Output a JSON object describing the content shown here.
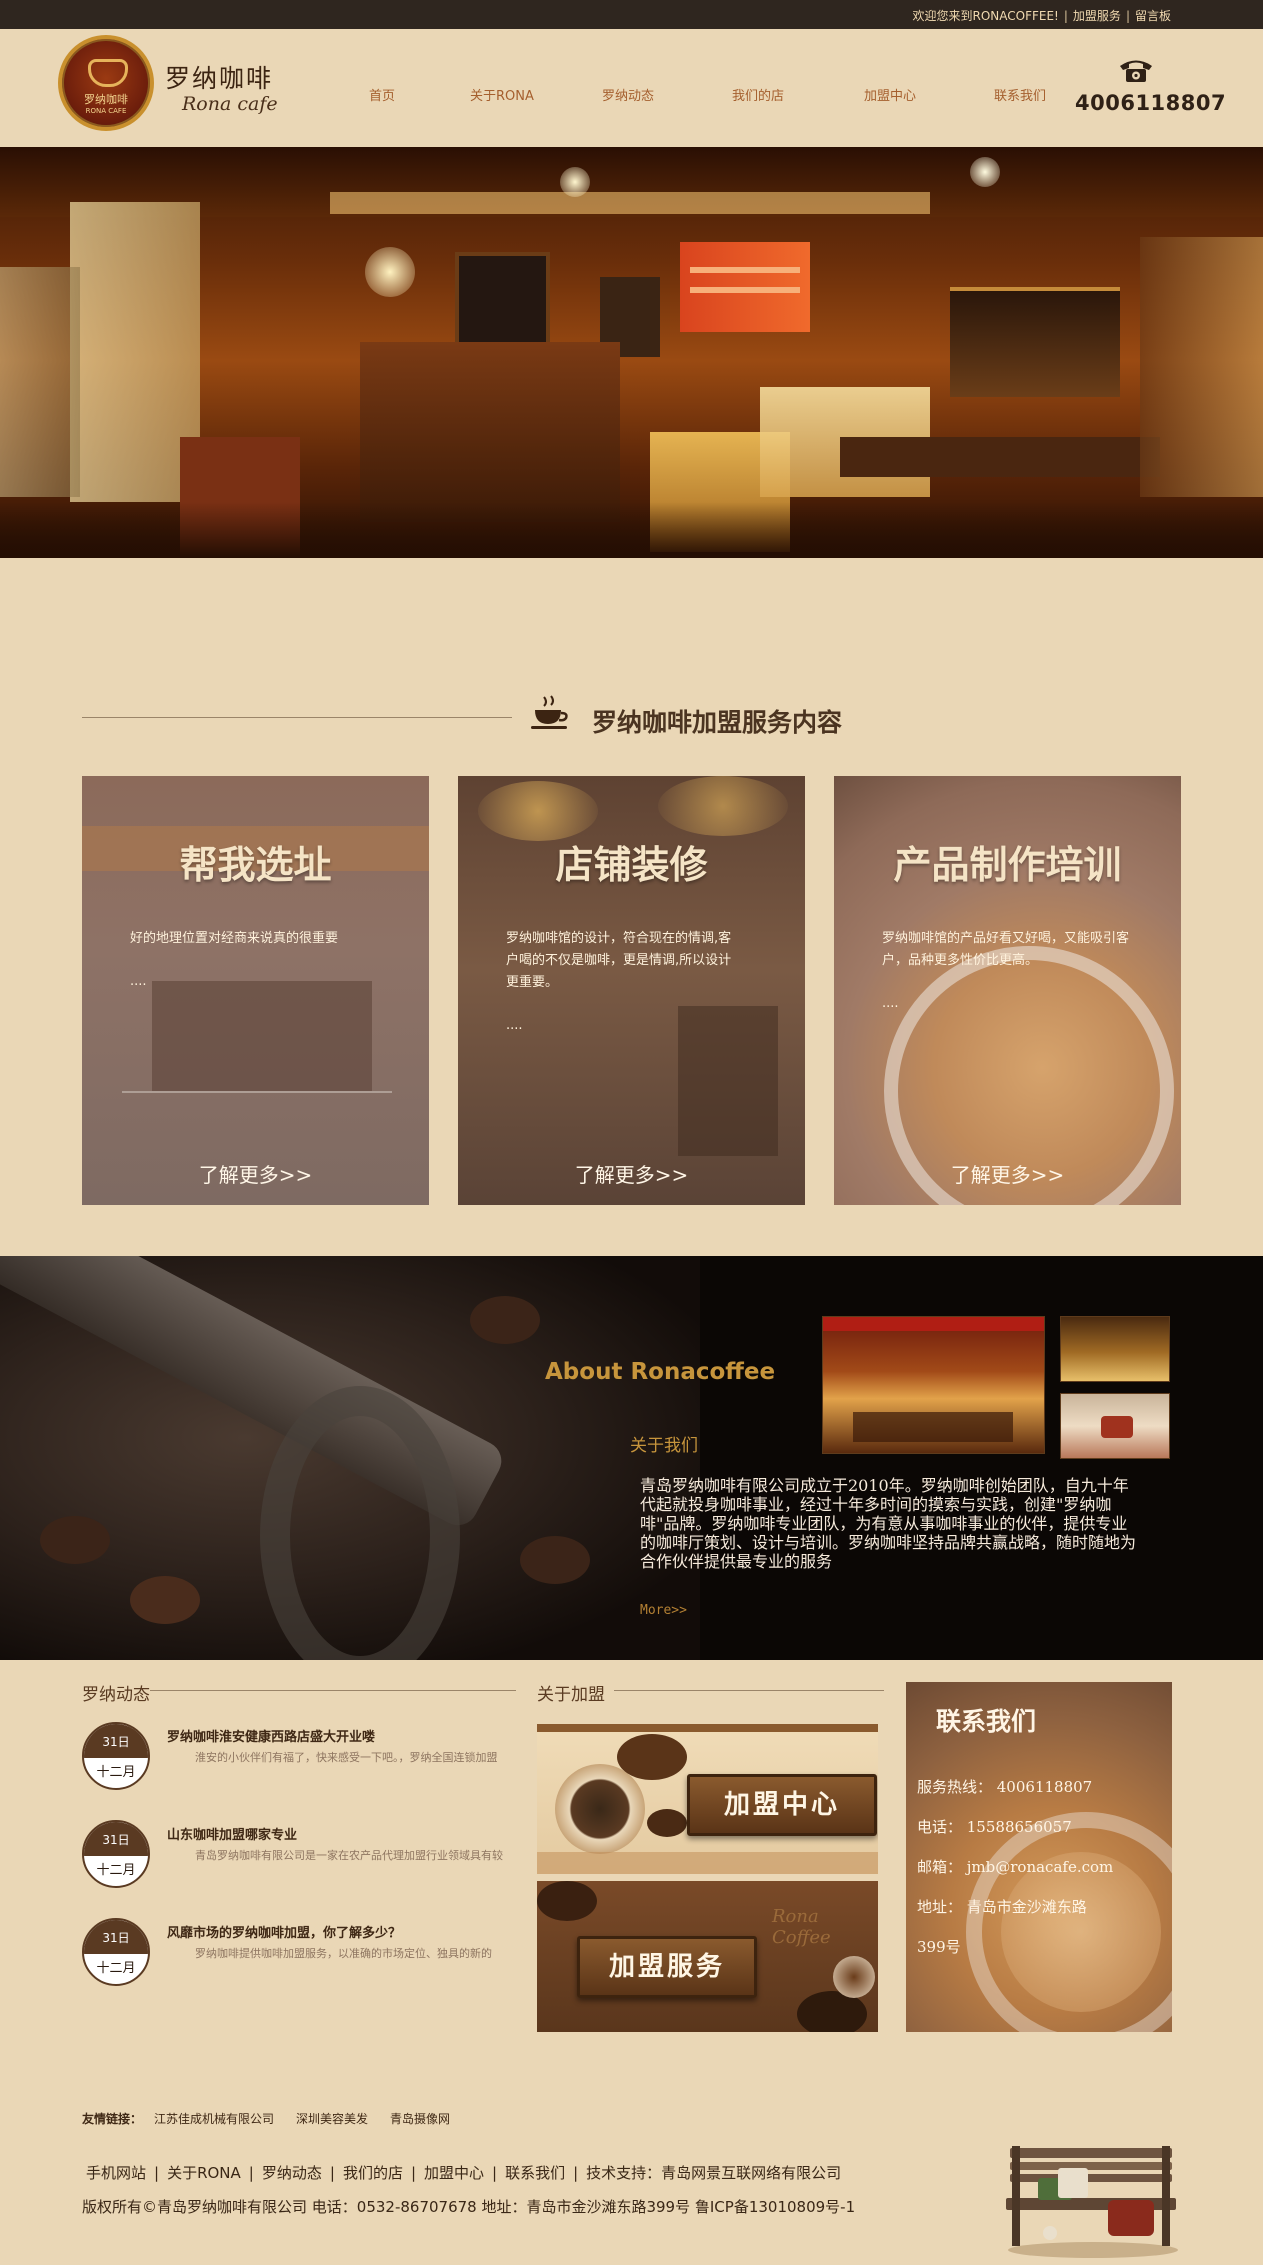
{
  "topbar": {
    "welcome": "欢迎您来到RONACOFFEE!",
    "sep1": "|",
    "franchise_link": "加盟服务",
    "sep2": "|",
    "guestbook_link": "留言板"
  },
  "header": {
    "logo_cn": "罗纳咖啡",
    "logo_en": "Rona cafe",
    "badge_cn": "罗纳咖啡",
    "badge_en": "RONA CAFE",
    "nav": [
      "首页",
      "关于RONA",
      "罗纳动态",
      "我们的店",
      "加盟中心",
      "联系我们"
    ],
    "phone": "4006118807",
    "phone_icon": "phone-icon"
  },
  "services": {
    "title": "罗纳咖啡加盟服务内容",
    "icon": "coffee-cup-icon",
    "cards": [
      {
        "title": "帮我选址",
        "desc": "好的地理位置对经商来说真的很重要",
        "dots": "....",
        "more": "了解更多>>"
      },
      {
        "title": "店铺装修",
        "desc": "罗纳咖啡馆的设计，符合现在的情调,客户喝的不仅是咖啡，更是情调,所以设计更重要。",
        "dots": "....",
        "more": "了解更多>>"
      },
      {
        "title": "产品制作培训",
        "desc": "罗纳咖啡馆的产品好看又好喝，又能吸引客户，品种更多性价比更高。",
        "dots": "....",
        "more": "了解更多>>"
      }
    ]
  },
  "about": {
    "title_en": "About Ronacoffee",
    "title_cn": "关于我们",
    "text": "青岛罗纳咖啡有限公司成立于2010年。罗纳咖啡创始团队，自九十年代起就投身咖啡事业，经过十年多时间的摸索与实践，创建\"罗纳咖啡\"品牌。罗纳咖啡专业团队，为有意从事咖啡事业的伙伴，提供专业的咖啡厅策划、设计与培训。罗纳咖啡坚持品牌共赢战略，随时随地为合作伙伴提供最专业的服务",
    "more": "More>>"
  },
  "news": {
    "title": "罗纳动态",
    "items": [
      {
        "day": "31日",
        "month": "十二月",
        "title": "罗纳咖啡淮安健康西路店盛大开业喽",
        "desc": "淮安的小伙伴们有福了，快来感受一下吧。，罗纳全国连锁加盟"
      },
      {
        "day": "31日",
        "month": "十二月",
        "title": "山东咖啡加盟哪家专业",
        "desc": "青岛罗纳咖啡有限公司是一家在农产品代理加盟行业领域具有较"
      },
      {
        "day": "31日",
        "month": "十二月",
        "title": "风靡市场的罗纳咖啡加盟，你了解多少？",
        "desc": "罗纳咖啡提供咖啡加盟服务，以准确的市场定位、独具的新的"
      }
    ]
  },
  "join": {
    "title": "关于加盟",
    "sign1": "加盟中心",
    "sign2": "加盟服务",
    "img2_script": "Rona Coffee"
  },
  "contact": {
    "title": "联系我们",
    "hotline": "服务热线：  4006118807",
    "phone": "电话：  15588656057",
    "email": "邮箱：  jmb@ronacafe.com",
    "address_line1": "地址：  青岛市金沙滩东路",
    "address_line2": "399号"
  },
  "footer": {
    "friend_label": "友情链接：",
    "friends": [
      "江苏佳成机械有限公司",
      "深圳美容美发",
      "青岛摄像网"
    ],
    "nav": [
      "手机网站",
      "关于RONA",
      "罗纳动态",
      "我们的店",
      "加盟中心",
      "联系我们",
      "技术支持：青岛网景互联网络有限公司"
    ],
    "separator": "|",
    "copyright": "版权所有©青岛罗纳咖啡有限公司  电话：0532-86707678  地址：青岛市金沙滩东路399号  鲁ICP备13010809号-1"
  },
  "colors": {
    "background": "#ead7b6",
    "topbar": "#2f261f",
    "accent": "#c7953c",
    "nav_text": "#a55f2e"
  }
}
